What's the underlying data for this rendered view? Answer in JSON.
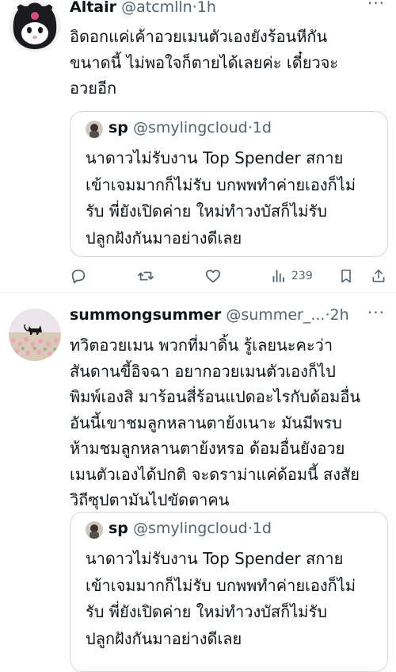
{
  "tweets": [
    {
      "author": {
        "name": "Altair",
        "handle": "@atcmlln",
        "separator": "·",
        "time": "1h"
      },
      "more_label": "···",
      "text": "อิดอกแค่เค้าอวยเมนตัวเองยังร้อนหีกัน\nขนาดนี้ ไม่พอใจก็ตายได้เลยค่ะ เดี๋ยวจะ\nอวยอีก",
      "quote": {
        "author": {
          "name": "sp",
          "handle": "@smylingcloud",
          "separator": "·",
          "time": "1d"
        },
        "text": "นาดาวไม่รับงาน Top Spender สกาย\nเข้าเจมมากก็ไม่รับ บกพพทำค่ายเองก็ไม่\nรับ พี่ยังเปิดค่าย ใหม่ทำวงบัสก็ไม่รับ\nปลูกฝังกันมาอย่างดีเลย"
      },
      "actions": {
        "views": "239"
      }
    },
    {
      "author": {
        "name": "summongsummer",
        "handle": "@summer_...",
        "separator": "·",
        "time": "2h"
      },
      "more_label": "···",
      "text": "ทวิตอวยเมน พวกที่มาดิ้น รู้เลยนะคะว่า\nสันดานขี้อิจฉา อยากอวยเมนตัวเองก็ไป\nพิมพ์เองสิ มาร้อนสี่ร้อนแปดอะไรกับด้อมอื่น\nอันนี้เขาชมลูกหลานตาย้งเนาะ มันมีพรบ\nห้ามชมลูกหลานตาย้งหรอ ด้อมอื่นยังอวย\nเมนตัวเองได้ปกติ จะดราม่าแค่ด้อมนี้ สงสัย\nวิถีซุปตามันไปขัดตาคน",
      "quote": {
        "author": {
          "name": "sp",
          "handle": "@smylingcloud",
          "separator": "·",
          "time": "1d"
        },
        "text": "นาดาวไม่รับงาน Top Spender สกาย\nเข้าเจมมากก็ไม่รับ บกพพทำค่ายเองก็ไม่\nรับ พี่ยังเปิดค่าย ใหม่ทำวงบัสก็ไม่รับ\nปลูกฝังกันมาอย่างดีเลย"
      }
    }
  ],
  "icons": [
    "reply-icon",
    "retweet-icon",
    "like-icon",
    "views-icon",
    "bookmark-icon",
    "share-icon"
  ]
}
